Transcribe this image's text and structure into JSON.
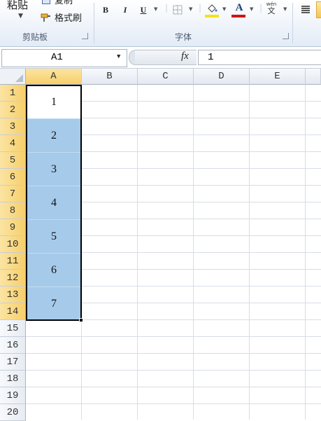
{
  "ribbon": {
    "clipboard": {
      "paste_label": "粘贴",
      "copy_label": "复制",
      "format_painter_label": "格式刷",
      "group_label": "剪贴板"
    },
    "font": {
      "bold": "B",
      "italic": "I",
      "underline": "U",
      "font_color_letter": "A",
      "wen_top": "wén",
      "wen_char": "文",
      "group_label": "字体",
      "fill_color": "#f5e21b",
      "font_color": "#d21414"
    }
  },
  "formula_bar": {
    "name_box": "A1",
    "fx_label": "fx",
    "value": "1"
  },
  "columns": [
    "A",
    "B",
    "C",
    "D",
    "E"
  ],
  "rows": [
    "1",
    "2",
    "3",
    "4",
    "5",
    "6",
    "7",
    "8",
    "9",
    "10",
    "11",
    "12",
    "13",
    "14",
    "15",
    "16",
    "17",
    "18",
    "19",
    "20"
  ],
  "cells": {
    "merged_values": [
      "1",
      "2",
      "3",
      "4",
      "5",
      "6",
      "7"
    ]
  },
  "colors": {
    "selection_fill": "#a6caea",
    "header_selected": "#f7cf6a"
  }
}
